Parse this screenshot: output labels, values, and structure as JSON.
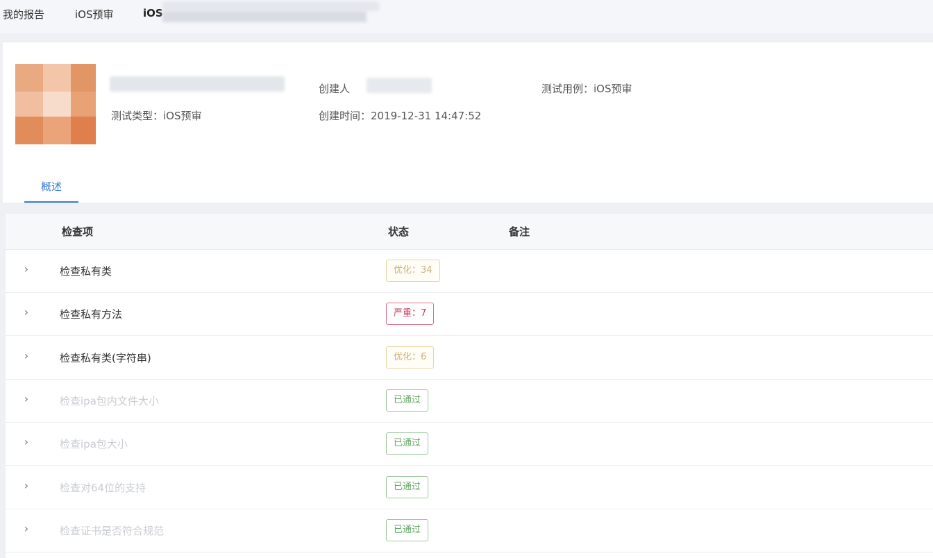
{
  "breadcrumb": {
    "items": [
      "我的报告",
      "iOS预审",
      "iOS"
    ]
  },
  "report": {
    "test_type": "测试类型：iOS预审",
    "creator_label": "创建人",
    "created_time": "创建时间：2019-12-31 14:47:52",
    "test_case": "测试用例：iOS预审"
  },
  "tabs": [
    {
      "label": "概述",
      "active": true
    }
  ],
  "table": {
    "headers": [
      "检查项",
      "状态",
      "备注"
    ],
    "rows": [
      {
        "name": "检查私有类",
        "status": "优化：34",
        "level": "warn",
        "faded": false
      },
      {
        "name": "检查私有方法",
        "status": "严重：7",
        "level": "error",
        "faded": false
      },
      {
        "name": "检查私有类(字符串)",
        "status": "优化：6",
        "level": "warn",
        "faded": false
      },
      {
        "name": "检查ipa包内文件大小",
        "status": "已通过",
        "level": "pass",
        "faded": true
      },
      {
        "name": "检查ipa包大小",
        "status": "已通过",
        "level": "pass",
        "faded": true
      },
      {
        "name": "检查对64位的支持",
        "status": "已通过",
        "level": "pass",
        "faded": true
      },
      {
        "name": "检查证书是否符合规范",
        "status": "已通过",
        "level": "pass",
        "faded": true
      }
    ]
  },
  "icons": {
    "expand": "chevron-right-icon"
  },
  "colors": {
    "accent": "#3a7bd5",
    "warn": "#c9b27a",
    "error": "#c23b5a",
    "pass": "#67a867",
    "avatar": "#e8a478"
  }
}
